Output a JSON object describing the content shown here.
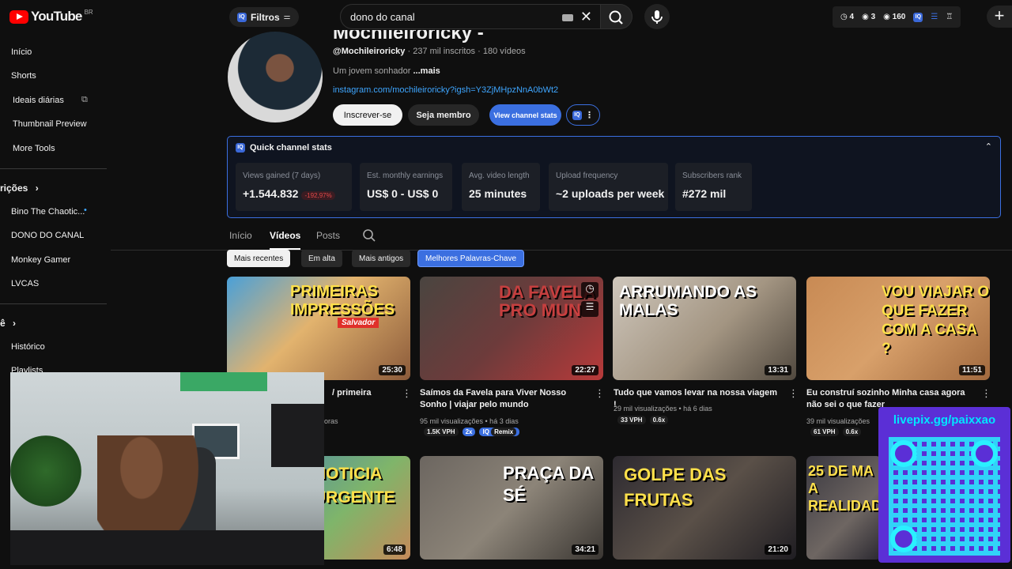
{
  "topbar": {
    "logo_word": "YouTube",
    "logo_country": "BR",
    "filters_label": "Filtros",
    "search_value": "dono do canal",
    "stats": [
      "4",
      "3",
      "160"
    ]
  },
  "sidebar": {
    "items_top": [
      "Início",
      "Shorts",
      "Ideais diárias",
      "Thumbnail Preview",
      "More Tools"
    ],
    "subscriptions_head": "rições",
    "subscriptions": [
      "Bino The Chaotic...",
      "DONO DO CANAL",
      "Monkey Gamer",
      "LVCAS"
    ],
    "you_head": "ê",
    "you_items": [
      "Histórico",
      "Playlists"
    ]
  },
  "channel": {
    "name": "Mochileiroricky -",
    "handle": "@Mochileiroricky",
    "meta": " · 237 mil inscritos · 180 vídeos",
    "desc": "Um jovem sonhador ",
    "desc_more": "...mais",
    "link": "instagram.com/mochileiroricky?igsh=Y3ZjMHpzNnA0bWt2",
    "subscribe_label": "Inscrever-se",
    "member_label": "Seja membro",
    "stats_label": "View channel stats"
  },
  "quick_stats": {
    "title": "Quick channel stats",
    "cards": [
      {
        "label": "Views gained (7 days)",
        "value": "+1.544.832",
        "delta": "-192,97%"
      },
      {
        "label": "Est. monthly earnings",
        "value": "US$ 0 - US$ 0"
      },
      {
        "label": "Avg. video length",
        "value": "25 minutes"
      },
      {
        "label": "Upload frequency",
        "value": "~2 uploads per week"
      },
      {
        "label": "Subscribers rank",
        "value": "#272 mil"
      }
    ]
  },
  "tabs": [
    "Início",
    "Vídeos",
    "Posts"
  ],
  "chips": [
    "Mais recentes",
    "Em alta",
    "Mais antigos",
    "Melhores Palavras-Chave"
  ],
  "videos": [
    {
      "thumb_text": "PRIMEIRAS IMPRESSÕES",
      "thumb_sub": "Salvador",
      "duration": "25:30",
      "title": "/ primeira",
      "meta": "oras"
    },
    {
      "thumb_text": "DA FAVELA PRO MUN",
      "duration": "22:27",
      "title": "Saímos da Favela para Viver Nosso Sonho | viajar pelo mundo",
      "meta": "95 mil visualizações • há 3 dias",
      "vph": "1.5K VPH",
      "mult": "2x",
      "remix": "Remix"
    },
    {
      "thumb_text": "ARRUMANDO AS MALAS",
      "duration": "13:31",
      "title": "Tudo que vamos levar na nossa viagem !",
      "meta": "29 mil visualizações • há 6 dias",
      "vph": "33 VPH",
      "mult": "0.6x"
    },
    {
      "thumb_text": "VOU VIAJAR O QUE FAZER COM A CASA ?",
      "duration": "11:51",
      "title": "Eu construí sozinho Minha casa agora não sei o que fazer",
      "meta": "39 mil visualizações",
      "vph": "61 VPH",
      "mult": "0.6x"
    },
    {
      "thumb_text": "NOTICIA URGENTE",
      "duration": "6:48"
    },
    {
      "thumb_text": "PRAÇA DA SÉ",
      "duration": "34:21"
    },
    {
      "thumb_text": "GOLPE DAS FRUTAS",
      "duration": "21:20"
    },
    {
      "thumb_text": "25 DE MA A REALIDAD",
      "duration": ""
    }
  ],
  "overlay": {
    "livepix": "livepix.gg/paixxao"
  },
  "colors": {
    "accent": "#3ea6ff",
    "brand": "#ff0000",
    "stats_border": "#3b6fe0",
    "qr_bg": "#5b2fd6"
  }
}
